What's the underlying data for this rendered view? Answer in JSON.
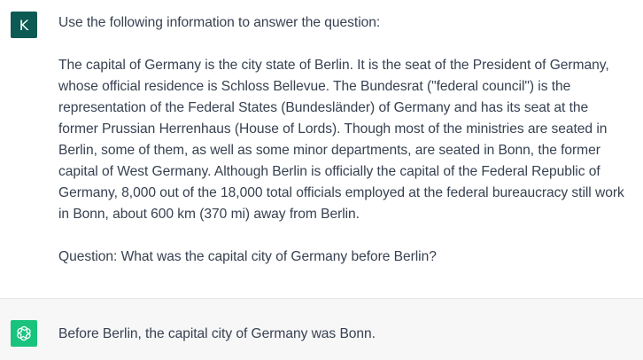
{
  "conversation": {
    "user": {
      "avatar_letter": "K",
      "avatar_color": "#0c5a53",
      "intro": "Use the following information to answer the question:",
      "context": "The capital of Germany is the city state of Berlin. It is the seat of the President of Germany, whose official residence is Schloss Bellevue. The Bundesrat (\"federal council\") is the representation of the Federal States (Bundesländer) of Germany and has its seat at the former Prussian Herrenhaus (House of Lords). Though most of the ministries are seated in Berlin, some of them, as well as some minor departments, are seated in Bonn, the former capital of West Germany. Although Berlin is officially the capital of the Federal Republic of Germany, 8,000 out of the 18,000 total officials employed at the federal bureaucracy still work in Bonn, about 600 km (370 mi) away from Berlin.",
      "question": "Question: What was the capital city of Germany before Berlin?"
    },
    "assistant": {
      "avatar_icon": "openai-logo-icon",
      "avatar_color": "#19c37d",
      "answer": "Before Berlin, the capital city of Germany was Bonn."
    }
  }
}
